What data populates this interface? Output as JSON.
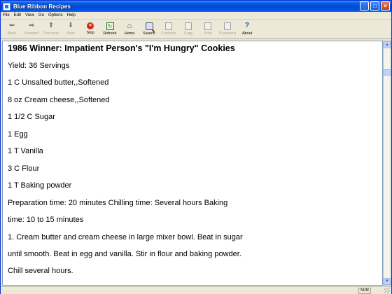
{
  "window": {
    "title": "Blue Ribbon Recipes"
  },
  "menu": [
    "File",
    "Edit",
    "View",
    "Go",
    "Options",
    "Help"
  ],
  "toolbar": [
    {
      "label": "Back",
      "icon": "back-arrow-icon",
      "enabled": false
    },
    {
      "label": "Forward",
      "icon": "forward-arrow-icon",
      "enabled": false
    },
    {
      "label": "Previous",
      "icon": "previous-arrow-icon",
      "enabled": false
    },
    {
      "label": "Next",
      "icon": "next-arrow-icon",
      "enabled": false
    },
    {
      "label": "Stop",
      "icon": "stop-icon",
      "enabled": true
    },
    {
      "label": "Refresh",
      "icon": "refresh-icon",
      "enabled": true
    },
    {
      "label": "Home",
      "icon": "home-icon",
      "enabled": true
    },
    {
      "label": "Search",
      "icon": "search-icon",
      "enabled": true
    },
    {
      "label": "Contents",
      "icon": "contents-icon",
      "enabled": false
    },
    {
      "label": "Copy",
      "icon": "copy-icon",
      "enabled": false
    },
    {
      "label": "Print",
      "icon": "print-icon",
      "enabled": false
    },
    {
      "label": "Password",
      "icon": "password-icon",
      "enabled": false
    },
    {
      "label": "About",
      "icon": "about-icon",
      "enabled": true
    }
  ],
  "recipe": {
    "title": "1986 Winner: Impatient Person's \"I'm Hungry\" Cookies",
    "lines": [
      "Yield: 36 Servings",
      "1 C Unsalted butter,,Softened",
      "8 oz Cream cheese,,Softened",
      "1 1/2 C Sugar",
      "1 Egg",
      "1 T Vanilla",
      "3 C Flour",
      "1 T Baking powder",
      "Preparation time: 20 minutes Chilling time: Several hours Baking",
      "time: 10 to 15 minutes",
      "1. Cream butter and cream cheese in large mixer bowl. Beat in sugar",
      "until smooth. Beat in egg and vanilla. Stir in flour and baking powder.",
      "Chill several hours."
    ]
  },
  "status": {
    "num": "NUM"
  },
  "colors": {
    "titlebar": "#0054e3",
    "stop": "#d42a1c"
  }
}
